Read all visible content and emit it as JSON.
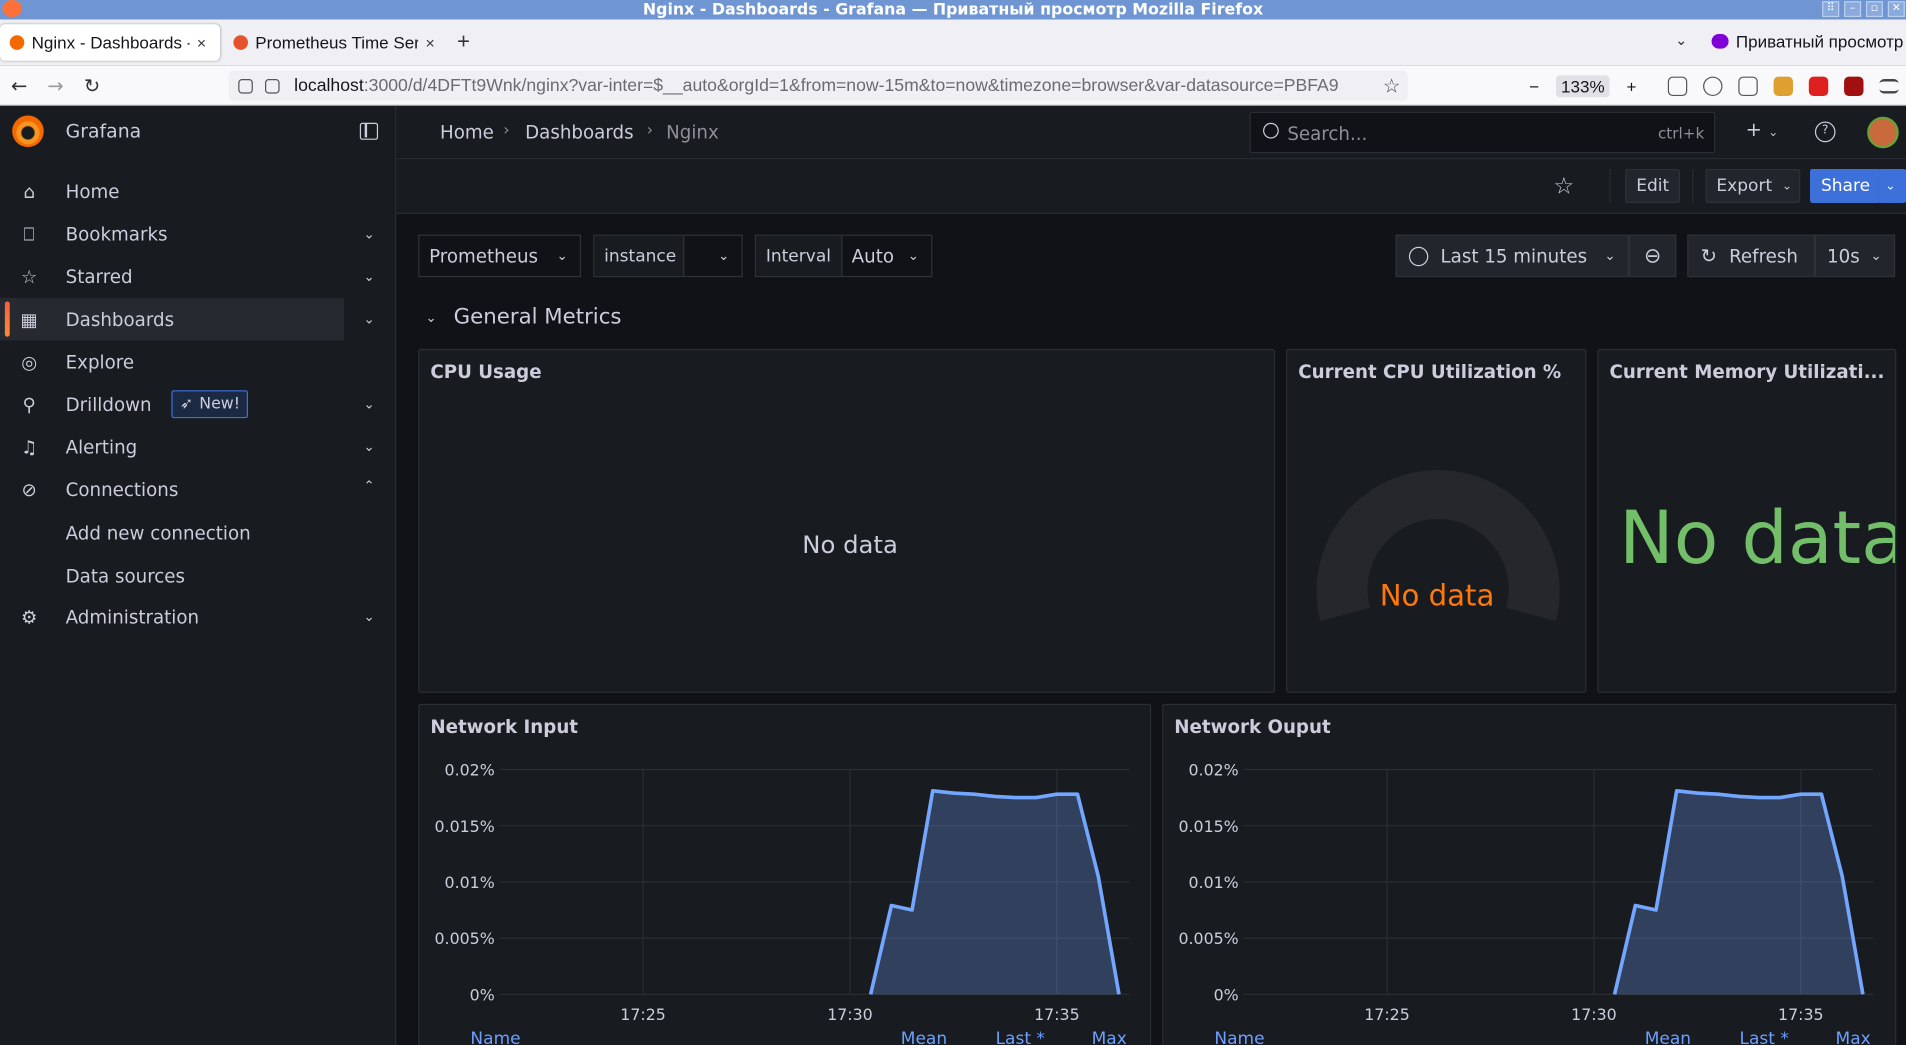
{
  "window": {
    "title": "Nginx - Dashboards - Grafana — Приватный просмотр Mozilla Firefox"
  },
  "browser": {
    "tabs": [
      {
        "title": "Nginx - Dashboards - (",
        "close": "×"
      },
      {
        "title": "Prometheus Time Seri",
        "close": "×"
      }
    ],
    "new_tab": "+",
    "list_tabs": "⌄",
    "private_label": "Приватный просмотр",
    "url_host": "localhost",
    "url_rest": ":3000/d/4DFTt9Wnk/nginx?var-inter=$__auto&orgId=1&from=now-15m&to=now&timezone=browser&var-datasource=PBFA9",
    "zoom_out": "−",
    "zoom": "133%",
    "zoom_in": "+"
  },
  "sidebar": {
    "brand": "Grafana",
    "items": [
      {
        "label": "Home",
        "icon": "home-icon"
      },
      {
        "label": "Bookmarks",
        "icon": "bookmark-icon"
      },
      {
        "label": "Starred",
        "icon": "star-icon"
      },
      {
        "label": "Dashboards",
        "icon": "apps-icon"
      },
      {
        "label": "Explore",
        "icon": "compass-icon"
      },
      {
        "label": "Drilldown",
        "icon": "drilldown-icon",
        "badge": "New!"
      },
      {
        "label": "Alerting",
        "icon": "bell-icon"
      },
      {
        "label": "Connections",
        "icon": "connections-icon"
      },
      {
        "label": "Administration",
        "icon": "cog-icon"
      }
    ],
    "sub_items": [
      "Add new connection",
      "Data sources"
    ]
  },
  "topbar": {
    "breadcrumb": [
      "Home",
      "Dashboards",
      "Nginx"
    ],
    "search_placeholder": "Search...",
    "search_shortcut": "ctrl+k",
    "plus": "+"
  },
  "toolbar": {
    "edit": "Edit",
    "export": "Export",
    "share": "Share"
  },
  "variables": {
    "datasource": "Prometheus",
    "instance_label": "instance",
    "interval_label": "Interval",
    "interval_value": "Auto"
  },
  "timepicker": {
    "range": "Last 15 minutes",
    "refresh": "Refresh",
    "refresh_interval": "10s"
  },
  "row": {
    "title": "General Metrics"
  },
  "panels": {
    "cpu_usage": {
      "title": "CPU Usage",
      "nodata": "No data"
    },
    "cpu_util": {
      "title": "Current CPU Utilization %",
      "nodata": "No data"
    },
    "mem_util": {
      "title": "Current Memory Utilizati...",
      "nodata": "No data"
    },
    "net_in": {
      "title": "Network Input"
    },
    "net_out": {
      "title": "Network Ouput"
    },
    "legend": {
      "name": "Name",
      "mean": "Mean",
      "last": "Last *",
      "max": "Max"
    }
  },
  "colors": {
    "accent": "#3d71d9",
    "series": "#73a6ff",
    "stat_green": "#73bf69",
    "gauge_orange": "#ff780a"
  },
  "chart_data": [
    {
      "type": "area",
      "title": "Network Input",
      "x": [
        "17:30:30",
        "17:31:00",
        "17:31:30",
        "17:32:00",
        "17:32:30",
        "17:33:00",
        "17:33:30",
        "17:34:00",
        "17:34:30",
        "17:35:00",
        "17:35:30",
        "17:36:00",
        "17:36:30"
      ],
      "values": [
        0,
        0.0079,
        0.0075,
        0.0181,
        0.0179,
        0.0178,
        0.0176,
        0.0175,
        0.0175,
        0.0178,
        0.0178,
        0.0105,
        0
      ],
      "x_ticks": [
        "17:25",
        "17:30",
        "17:35"
      ],
      "y_ticks": [
        "0%",
        "0.005%",
        "0.01%",
        "0.015%",
        "0.02%"
      ],
      "ylim": [
        0,
        0.02
      ],
      "unit": "%"
    },
    {
      "type": "area",
      "title": "Network Ouput",
      "x": [
        "17:30:30",
        "17:31:00",
        "17:31:30",
        "17:32:00",
        "17:32:30",
        "17:33:00",
        "17:33:30",
        "17:34:00",
        "17:34:30",
        "17:35:00",
        "17:35:30",
        "17:36:00",
        "17:36:30"
      ],
      "values": [
        0,
        0.0079,
        0.0075,
        0.0181,
        0.0179,
        0.0178,
        0.0176,
        0.0175,
        0.0175,
        0.0178,
        0.0178,
        0.0105,
        0
      ],
      "x_ticks": [
        "17:25",
        "17:30",
        "17:35"
      ],
      "y_ticks": [
        "0%",
        "0.005%",
        "0.01%",
        "0.015%",
        "0.02%"
      ],
      "ylim": [
        0,
        0.02
      ],
      "unit": "%"
    }
  ]
}
